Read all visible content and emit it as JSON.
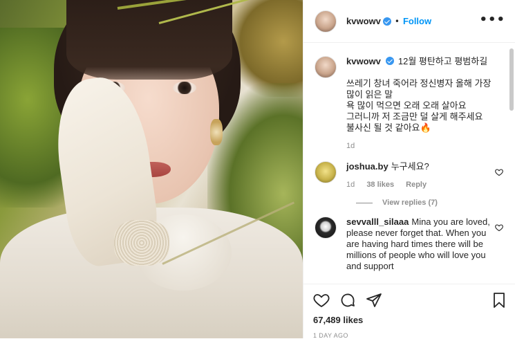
{
  "header": {
    "username": "kvwowv",
    "separator": "•",
    "follow_label": "Follow",
    "more_label": "•••"
  },
  "caption": {
    "username": "kvwowv",
    "text": "12월 평탄하고 평범하길\n\n쓰레기 창녀 죽어라 정신병자 올해 가장 많이 읽은 말\n욕 많이 먹으면 오래 오래 살아요\n그러니까 저 조금만 덜 살게 해주세요\n불사신 될 것 같아요🔥",
    "time": "1d"
  },
  "comments": [
    {
      "username": "joshua.by",
      "text": "누구세요?",
      "time": "1d",
      "likes": "38 likes",
      "reply_label": "Reply",
      "view_replies": "View replies (7)"
    },
    {
      "username": "sevvalll_silaaa",
      "text": "Mina you are loved, please never forget that. When you are having hard times there will be millions of people who will love you and support"
    }
  ],
  "footer": {
    "likes": "67,489 likes",
    "ago": "1 DAY AGO"
  },
  "icons": {
    "like": "heart-icon",
    "comment": "comment-icon",
    "share": "paper-plane-icon",
    "save": "bookmark-icon",
    "verified": "verified-badge-icon"
  },
  "colors": {
    "accent": "#0095f6",
    "verified": "#3897f0",
    "secondary_text": "#8e8e8e"
  }
}
